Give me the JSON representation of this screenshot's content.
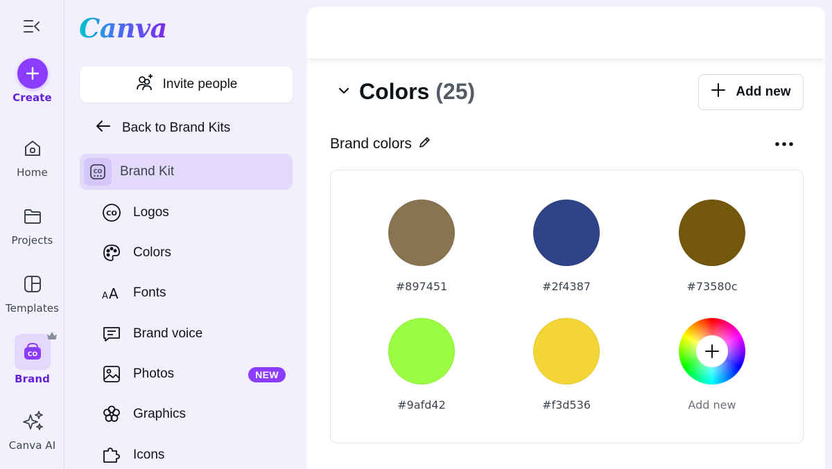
{
  "rail": {
    "create_label": "Create",
    "items": [
      {
        "label": "Home",
        "icon": "home-icon"
      },
      {
        "label": "Projects",
        "icon": "folder-icon"
      },
      {
        "label": "Templates",
        "icon": "templates-icon"
      },
      {
        "label": "Brand",
        "icon": "brand-icon"
      },
      {
        "label": "Canva AI",
        "icon": "sparkle-icon"
      }
    ]
  },
  "panel": {
    "logo": "Canva",
    "invite_label": "Invite people",
    "back_label": "Back to Brand Kits",
    "brand_kit_label": "Brand Kit",
    "items": [
      {
        "label": "Logos",
        "icon": "logo-co-icon"
      },
      {
        "label": "Colors",
        "icon": "palette-icon"
      },
      {
        "label": "Fonts",
        "icon": "font-icon"
      },
      {
        "label": "Brand voice",
        "icon": "message-icon"
      },
      {
        "label": "Photos",
        "icon": "image-icon",
        "badge": "NEW"
      },
      {
        "label": "Graphics",
        "icon": "flower-icon"
      },
      {
        "label": "Icons",
        "icon": "puzzle-icon"
      }
    ]
  },
  "main": {
    "section_title": "Colors",
    "section_count": "(25)",
    "add_new_label": "Add new",
    "group_title": "Brand colors",
    "swatches": [
      {
        "hex": "#897451",
        "color": "#897451"
      },
      {
        "hex": "#2f4387",
        "color": "#2f4387"
      },
      {
        "hex": "#73580c",
        "color": "#73580c"
      },
      {
        "hex": "#9afd42",
        "color": "#9afd42"
      },
      {
        "hex": "#f3d536",
        "color": "#f3d536"
      }
    ],
    "add_swatch_label": "Add new"
  },
  "colors": {
    "accent": "#8b3dff",
    "active_bg": "#e2d9fb"
  }
}
